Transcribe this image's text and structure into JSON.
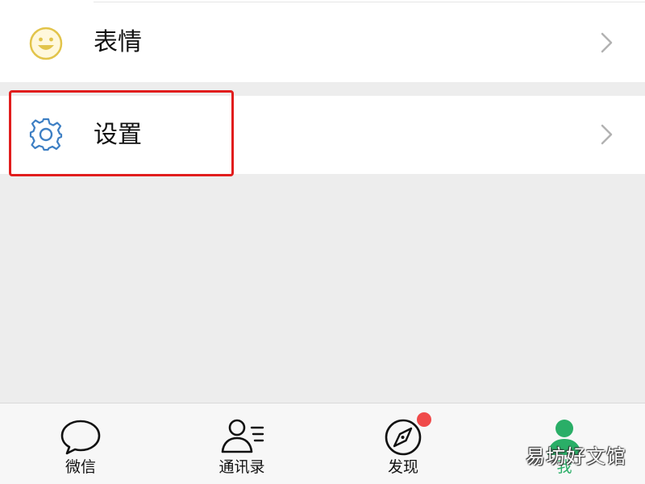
{
  "menu": {
    "items": [
      {
        "label": "表情",
        "icon": "smiley-face-icon"
      },
      {
        "label": "设置",
        "icon": "gear-icon",
        "highlighted": true
      }
    ]
  },
  "tabbar": {
    "tabs": [
      {
        "label": "微信",
        "icon": "chat-bubble-icon",
        "active": false
      },
      {
        "label": "通讯录",
        "icon": "contacts-icon",
        "active": false
      },
      {
        "label": "发现",
        "icon": "compass-icon",
        "active": false,
        "badge": "dot"
      },
      {
        "label": "我",
        "icon": "person-icon",
        "active": true
      }
    ]
  },
  "watermark": {
    "text": "易坊好文馆"
  },
  "colors": {
    "accent_green": "#2aae67",
    "highlight_red": "#e11d1d",
    "badge_red": "#f04a4a",
    "gear_blue": "#3d7fc4",
    "smiley_yellow": "#e2c44a"
  }
}
